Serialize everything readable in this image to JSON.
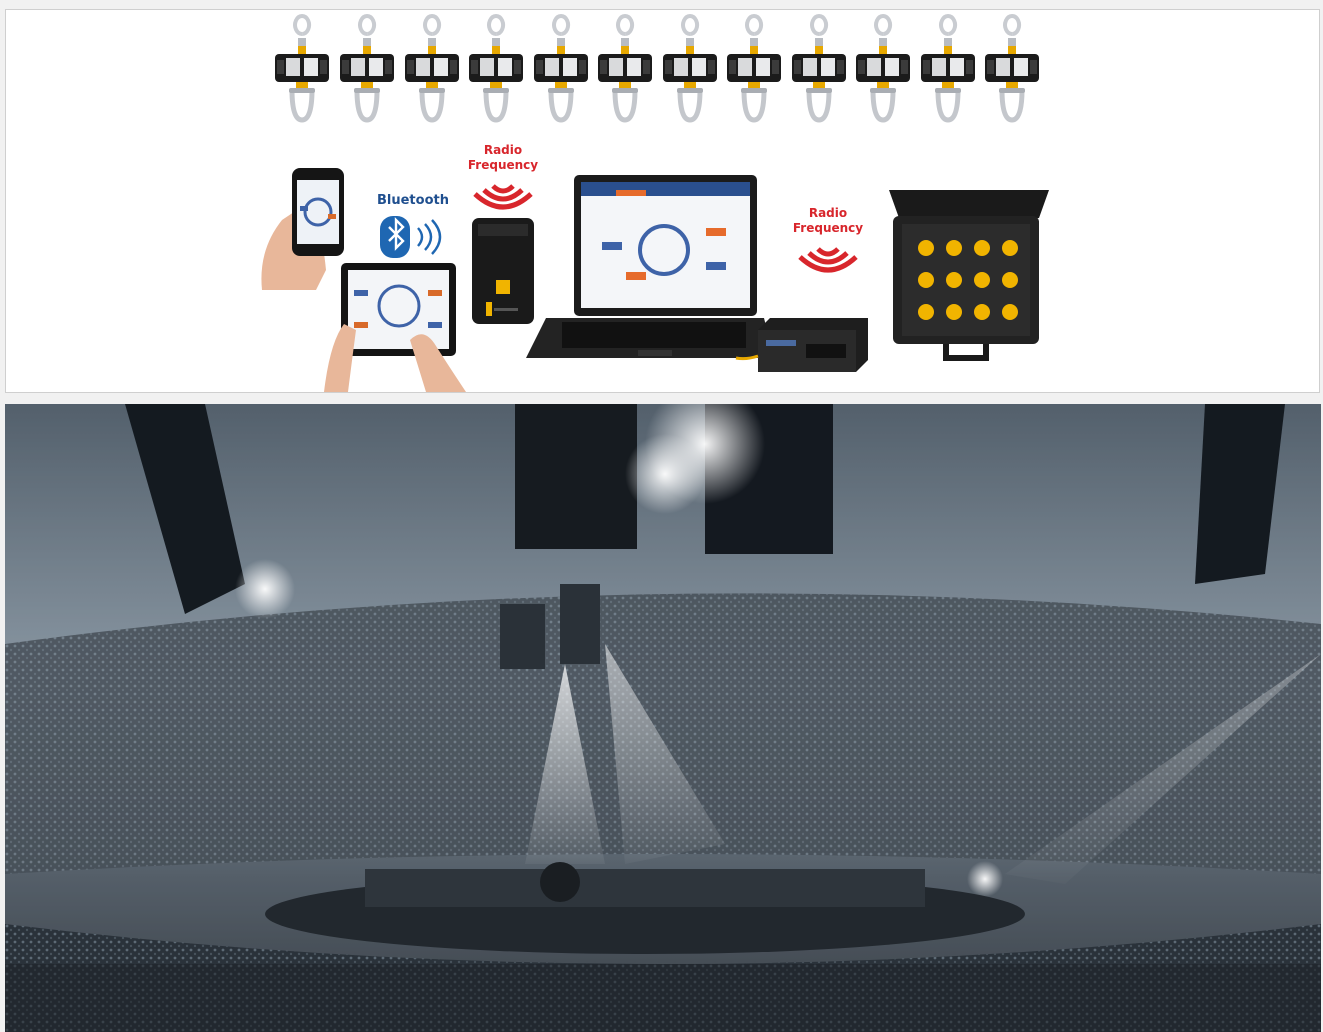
{
  "diagram": {
    "scale_count": 12,
    "bluetooth_label": "Bluetooth",
    "rf_label_1_line1": "Radio",
    "rf_label_1_line2": "Frequency",
    "rf_label_2_line1": "Radio",
    "rf_label_2_line2": "Frequency",
    "colors": {
      "rf_red": "#d8262c",
      "bluetooth_blue": "#1f67b2",
      "accent_yellow": "#f1b400"
    },
    "icons": [
      "crane-scale-icon",
      "smartphone-icon",
      "bluetooth-icon",
      "tablet-icon",
      "rf-remote-icon",
      "laptop-icon",
      "rf-base-station-icon",
      "carry-case-icon"
    ]
  },
  "photo": {
    "description_icon": "concert-arena-photo"
  }
}
